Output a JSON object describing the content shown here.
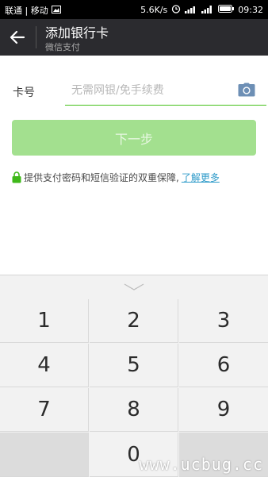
{
  "status_bar": {
    "carrier": "联通 | 移动",
    "speed": "5.6K/s",
    "time": "09:32"
  },
  "header": {
    "title": "添加银行卡",
    "subtitle": "微信支付"
  },
  "form": {
    "card_label": "卡号",
    "card_placeholder": "无需网银/免手续费",
    "next_button": "下一步"
  },
  "assurance": {
    "text": "提供支付密码和短信验证的双重保障,",
    "link": "了解更多"
  },
  "keyboard": {
    "keys": [
      "1",
      "2",
      "3",
      "4",
      "5",
      "6",
      "7",
      "8",
      "9",
      "",
      "0",
      ""
    ]
  },
  "watermark": "www.ucbug.cc",
  "colors": {
    "accent": "#45c01a",
    "button_disabled": "#a3e08f",
    "header_bg": "#2b2b2f",
    "link": "#2d9ac9"
  }
}
